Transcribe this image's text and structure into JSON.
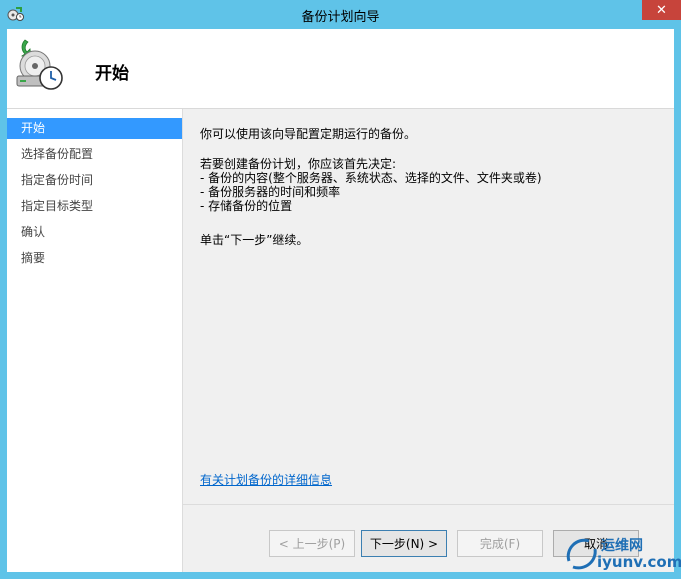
{
  "window": {
    "title": "备份计划向导",
    "close_label": "✕",
    "accent": "#5fc3e8"
  },
  "header": {
    "title": "开始",
    "icon": "backup-clock-icon"
  },
  "sidebar": {
    "items": [
      {
        "label": "开始",
        "active": true
      },
      {
        "label": "选择备份配置",
        "active": false
      },
      {
        "label": "指定备份时间",
        "active": false
      },
      {
        "label": "指定目标类型",
        "active": false
      },
      {
        "label": "确认",
        "active": false
      },
      {
        "label": "摘要",
        "active": false
      }
    ]
  },
  "main": {
    "intro": "你可以使用该向导配置定期运行的备份。",
    "prereq_title": "若要创建备份计划，你应该首先决定:",
    "prereq_items": [
      "- 备份的内容(整个服务器、系统状态、选择的文件、文件夹或卷)",
      "- 备份服务器的时间和频率",
      "- 存储备份的位置"
    ],
    "continue_text": "单击“下一步”继续。",
    "detail_link": "有关计划备份的详细信息"
  },
  "buttons": {
    "back": "< 上一步(P)",
    "next": "下一步(N) >",
    "finish": "完成(F)",
    "cancel": "取消"
  },
  "watermark": {
    "cn": "运维网",
    "en": "iyunv.com"
  }
}
